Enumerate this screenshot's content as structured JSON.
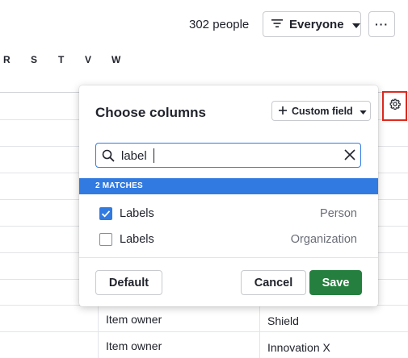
{
  "header": {
    "people_count": "302 people",
    "filter_label": "Everyone",
    "more_label": "···"
  },
  "alphabet": [
    "R",
    "S",
    "T",
    "V",
    "W"
  ],
  "table": {
    "rows": [
      {
        "col1": "Item owner",
        "col2": "Shield"
      },
      {
        "col1": "Item owner",
        "col2": "Innovation X"
      }
    ]
  },
  "popup": {
    "title": "Choose columns",
    "custom_field_label": "Custom field",
    "search": {
      "value": "label",
      "placeholder": ""
    },
    "matches_label": "2 MATCHES",
    "matches": [
      {
        "name": "Labels",
        "type": "Person",
        "checked": true
      },
      {
        "name": "Labels",
        "type": "Organization",
        "checked": false
      }
    ],
    "default_label": "Default",
    "cancel_label": "Cancel",
    "save_label": "Save"
  },
  "colors": {
    "accent_blue": "#317ae2",
    "save_green": "#25803f",
    "highlight_red": "#e0291e"
  },
  "icons": [
    "filter-icon",
    "chevron-down-icon",
    "more-icon",
    "gear-icon",
    "plus-icon",
    "search-icon",
    "close-icon",
    "checkmark-icon"
  ]
}
